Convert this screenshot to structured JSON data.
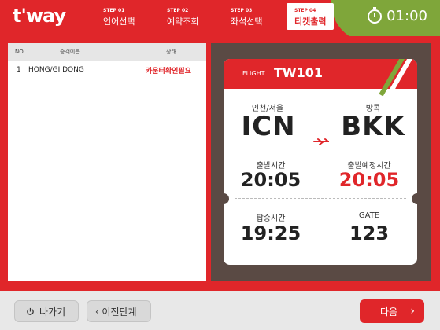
{
  "header": {
    "logo": "t'way",
    "steps": [
      {
        "num": "STEP 01",
        "label": "언어선택"
      },
      {
        "num": "STEP 02",
        "label": "예약조회"
      },
      {
        "num": "STEP 03",
        "label": "좌석선택"
      },
      {
        "num": "STEP 04",
        "label": "티켓출력"
      }
    ],
    "timer": "01:00"
  },
  "passengers": {
    "columns": [
      "NO",
      "승객이름",
      "상태"
    ],
    "rows": [
      {
        "no": "1",
        "name": "HONG/GI DONG",
        "status": "카운터확인필요"
      }
    ]
  },
  "ticket": {
    "flight_label": "FLIGHT",
    "flight_no": "TW101",
    "origin_city": "인천/서울",
    "origin_code": "ICN",
    "dest_city": "방콕",
    "dest_code": "BKK",
    "departure_label": "출발시간",
    "departure_time": "20:05",
    "est_departure_label": "출발예정시간",
    "est_departure_time": "20:05",
    "boarding_label": "탑승시간",
    "boarding_time": "19:25",
    "gate_label": "GATE",
    "gate": "123"
  },
  "footer": {
    "exit_label": "나가기",
    "back_label": "이전단계",
    "next_label": "다음"
  },
  "colors": {
    "brand_red": "#e0262a",
    "brand_green": "#7fa63a",
    "panel_brown": "#5a4a44"
  }
}
